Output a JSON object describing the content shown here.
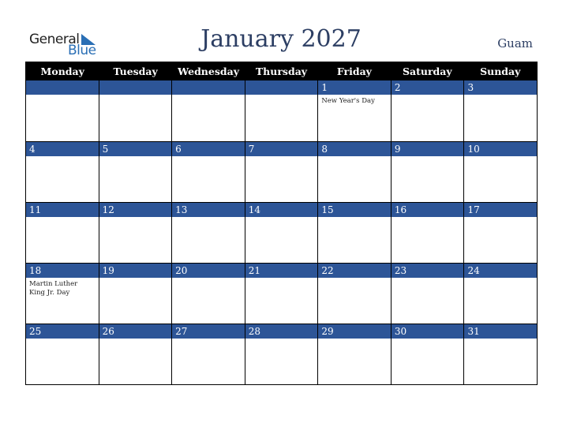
{
  "logo": {
    "line1": "General",
    "line2": "Blue"
  },
  "header": {
    "title": "January 2027",
    "region": "Guam"
  },
  "colors": {
    "accent": "#2d5597",
    "header_bg": "#000000",
    "title": "#2c3e63"
  },
  "weekdays": [
    "Monday",
    "Tuesday",
    "Wednesday",
    "Thursday",
    "Friday",
    "Saturday",
    "Sunday"
  ],
  "weeks": [
    [
      {
        "d": ""
      },
      {
        "d": ""
      },
      {
        "d": ""
      },
      {
        "d": ""
      },
      {
        "d": "1",
        "h": "New Year's Day"
      },
      {
        "d": "2"
      },
      {
        "d": "3"
      }
    ],
    [
      {
        "d": "4"
      },
      {
        "d": "5"
      },
      {
        "d": "6"
      },
      {
        "d": "7"
      },
      {
        "d": "8"
      },
      {
        "d": "9"
      },
      {
        "d": "10"
      }
    ],
    [
      {
        "d": "11"
      },
      {
        "d": "12"
      },
      {
        "d": "13"
      },
      {
        "d": "14"
      },
      {
        "d": "15"
      },
      {
        "d": "16"
      },
      {
        "d": "17"
      }
    ],
    [
      {
        "d": "18",
        "h": "Martin Luther King Jr. Day"
      },
      {
        "d": "19"
      },
      {
        "d": "20"
      },
      {
        "d": "21"
      },
      {
        "d": "22"
      },
      {
        "d": "23"
      },
      {
        "d": "24"
      }
    ],
    [
      {
        "d": "25"
      },
      {
        "d": "26"
      },
      {
        "d": "27"
      },
      {
        "d": "28"
      },
      {
        "d": "29"
      },
      {
        "d": "30"
      },
      {
        "d": "31"
      }
    ]
  ]
}
